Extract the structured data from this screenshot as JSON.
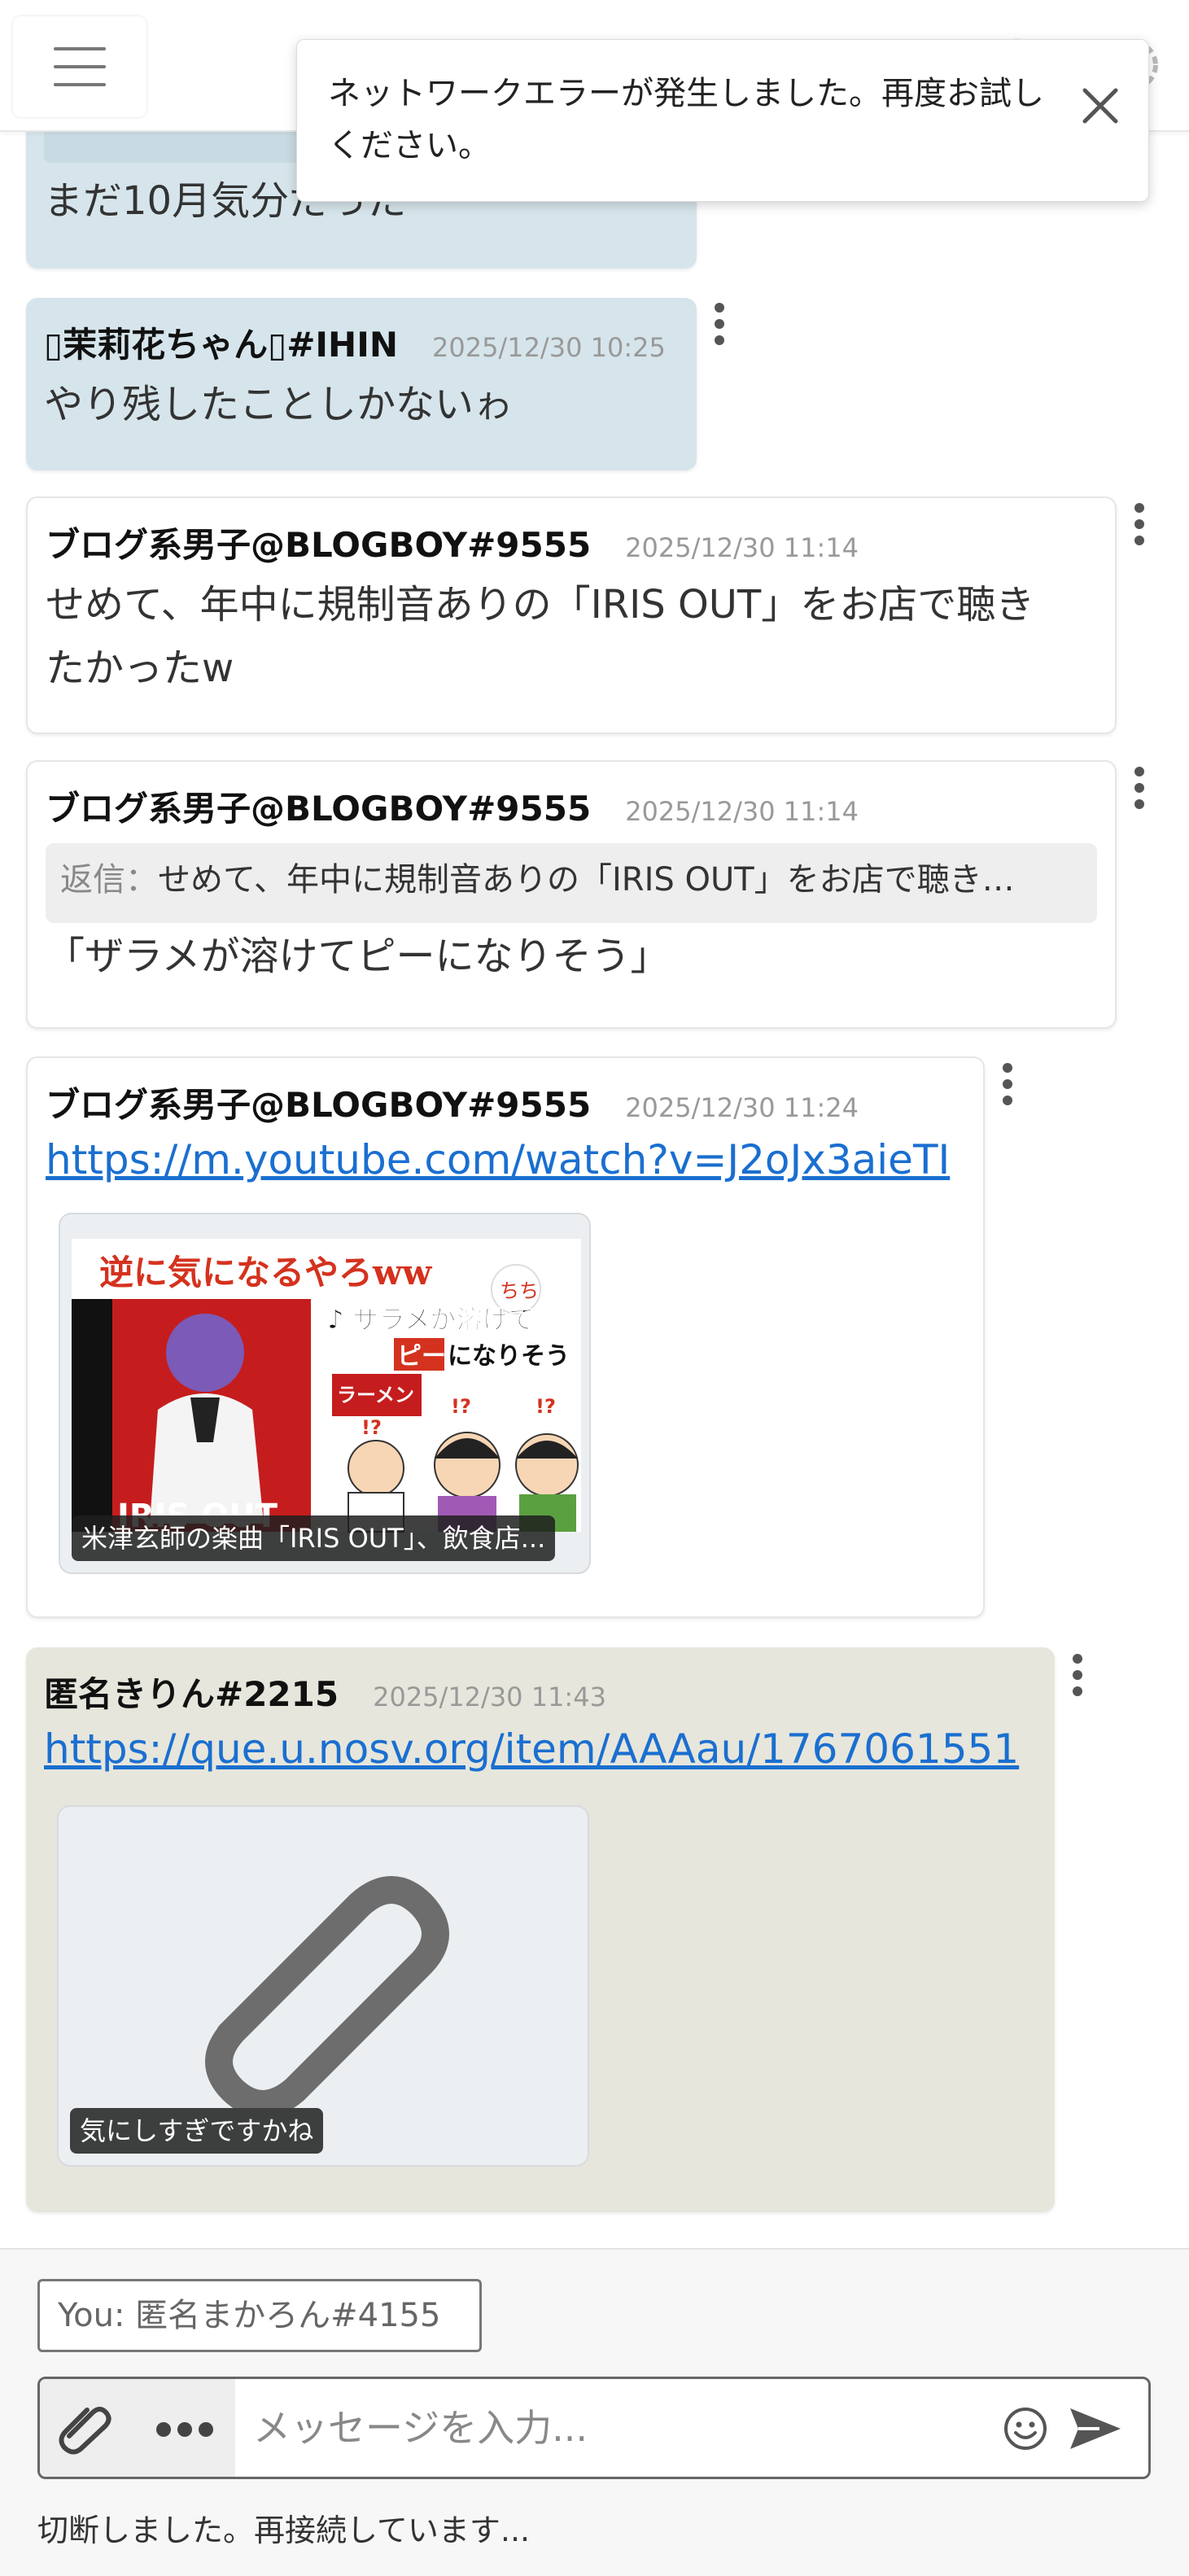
{
  "toast": {
    "message": "ネットワークエラーが発生しました。再度お試しください。"
  },
  "messages": [
    {
      "author": "",
      "timestamp": "",
      "text": "まだ10月気分だった"
    },
    {
      "author": "▯茉莉花ちゃん▯#IHIN",
      "timestamp": "2025/12/30 10:25",
      "text": "やり残したことしかないゎ"
    },
    {
      "author": "ブログ系男子@BLOGBOY#9555",
      "timestamp": "2025/12/30 11:14",
      "text": "せめて、年中に規制音ありの「IRIS OUT」をお店で聴き",
      "text2": "たかったw"
    },
    {
      "author": "ブログ系男子@BLOGBOY#9555",
      "timestamp": "2025/12/30 11:14",
      "reply_label": "返信：",
      "reply_text": "せめて、年中に規制音ありの「IRIS OUT」をお店で聴き…",
      "text": "「ザラメが溶けてピーになりそう」"
    },
    {
      "author": "ブログ系男子@BLOGBOY#9555",
      "timestamp": "2025/12/30 11:24",
      "link": "https://m.youtube.com/watch?v=J2oJx3aieTI",
      "preview": {
        "headline": "逆に気になるやろww",
        "badge": "ちち",
        "subtitle1": "♪ ザラメが溶けて",
        "subtitle2a": "ピー",
        "subtitle2b": "になりそう",
        "ramen_sign": "ラーメン",
        "ramen_mark": "!?",
        "mark1": "!?",
        "mark2": "!?",
        "caption": "米津玄師の楽曲「IRIS OUT」、飲食店..."
      }
    },
    {
      "author": "匿名きりん#2215",
      "timestamp": "2025/12/30 11:43",
      "link": "https://que.u.nosv.org/item/AAAau/1767061551",
      "preview": {
        "icon": "paperclip-icon",
        "caption": "気にしすぎですかね"
      }
    }
  ],
  "composer": {
    "you_label": "You: 匿名まかろん#4155",
    "placeholder": "メッセージを入力...",
    "status": "切断しました。再接続しています..."
  },
  "colors": {
    "blue_bubble": "#d6e5eb",
    "beige_bubble": "#e7e6dc",
    "link": "#1a6fd0"
  }
}
